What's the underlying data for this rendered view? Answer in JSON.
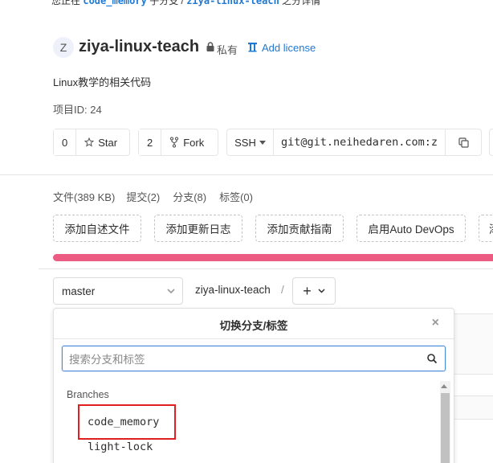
{
  "top_note": {
    "prefix": "您正在",
    "code": "code_memory",
    "middle": "子分支 / ",
    "path": "ziya-linux-teach",
    "suffix": "之分详情"
  },
  "project": {
    "avatar_letter": "Z",
    "name": "ziya-linux-teach",
    "visibility": "私有",
    "license_link": "Add license",
    "description": "Linux教学的相关代码",
    "id_label": "项目ID: 24"
  },
  "actions": {
    "star_count": "0",
    "star_label": "Star",
    "fork_count": "2",
    "fork_label": "Fork",
    "protocol": "SSH",
    "clone_url": "git@git.neihedaren.com:z"
  },
  "stats": {
    "files": "文件(389 KB)",
    "commits": "提交(2)",
    "branches": "分支(8)",
    "tags": "标签(0)"
  },
  "quick_actions": [
    "添加自述文件",
    "添加更新日志",
    "添加贡献指南",
    "启用Auto DevOps",
    "添"
  ],
  "repo_nav": {
    "branch": "master",
    "project_crumb": "ziya-linux-teach",
    "separator": "/",
    "plus": "+"
  },
  "branch_dropdown": {
    "title": "切换分支/标签",
    "close": "×",
    "search_placeholder": "搜索分支和标签",
    "section_label": "Branches",
    "items": [
      "code_memory",
      "light-lock"
    ]
  },
  "colors": {
    "accent": "#1f78d1",
    "progress": "#ec5b82",
    "highlight": "#e02020"
  }
}
